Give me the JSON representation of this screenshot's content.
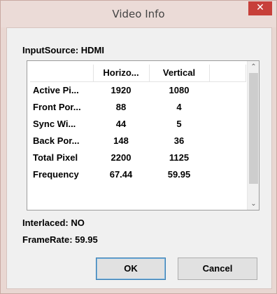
{
  "window": {
    "title": "Video Info",
    "close_glyph": "✕"
  },
  "input_source": "InputSource: HDMI",
  "table": {
    "headers": [
      "",
      "Horizo...",
      "Vertical",
      ""
    ],
    "rows": [
      {
        "name": "Active Pi...",
        "h": "1920",
        "v": "1080"
      },
      {
        "name": "Front Por...",
        "h": "88",
        "v": "4"
      },
      {
        "name": "Sync Wi...",
        "h": "44",
        "v": "5"
      },
      {
        "name": "Back Por...",
        "h": "148",
        "v": "36"
      },
      {
        "name": "Total Pixel",
        "h": "2200",
        "v": "1125"
      },
      {
        "name": "Frequency",
        "h": "67.44",
        "v": "59.95"
      }
    ]
  },
  "scrollbar": {
    "up_glyph": "⌃",
    "down_glyph": "⌄"
  },
  "interlaced": "Interlaced: NO",
  "framerate": "FrameRate: 59.95",
  "buttons": {
    "ok": "OK",
    "cancel": "Cancel"
  },
  "icons": {
    "close": "close-icon",
    "scroll_up": "chevron-up-icon",
    "scroll_down": "chevron-down-icon"
  }
}
